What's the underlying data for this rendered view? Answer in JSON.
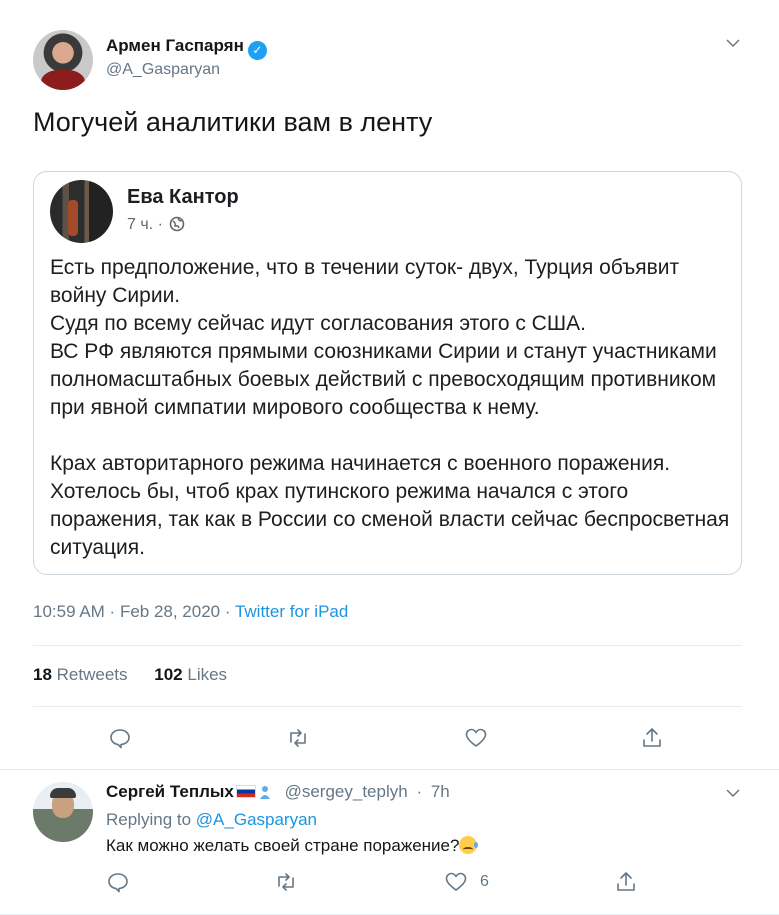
{
  "tweet": {
    "author_name": "Армен Гаспарян",
    "author_handle": "@A_Gasparyan",
    "text": "Могучей аналитики вам в ленту",
    "time": "10:59 AM",
    "date": "Feb 28, 2020",
    "source": "Twitter for iPad",
    "retweets_count": "18",
    "retweets_label": "Retweets",
    "likes_count": "102",
    "likes_label": "Likes"
  },
  "quoted_post": {
    "author_name": "Ева Кантор",
    "time_ago": "7 ч.",
    "body": "Есть предположение, что в течении суток- двух, Турция объявит войну Сирии.\nСудя по всему сейчас идут согласования этого с США.\nВС РФ являются прямыми союзниками Сирии и станут участниками полномасштабных боевых действий с превосходящим противником при явной симпатии мирового сообщества к нему.\n\nКрах авторитарного режима начинается с военного поражения.\nХотелось бы, чтоб крах путинского режима начался с этого поражения, так как в России со сменой власти сейчас беспросветная ситуация."
  },
  "reply": {
    "author_name": "Сергей Теплых",
    "author_handle": "@sergey_teplyh",
    "time": "7h",
    "replying_prefix": "Replying to",
    "replying_to": "@A_Gasparyan",
    "text": "Как можно желать своей стране поражение?",
    "likes_count": "6"
  },
  "icons": {
    "verified": "verified-badge-icon",
    "caret": "chevron-down-icon",
    "reply": "reply-icon",
    "retweet": "retweet-icon",
    "like": "heart-icon",
    "share": "share-icon",
    "globe": "globe-icon"
  },
  "colors": {
    "accent": "#1da1f2",
    "link": "#1b95e0",
    "secondary_text": "#657786",
    "divider": "#e6ecf0"
  }
}
